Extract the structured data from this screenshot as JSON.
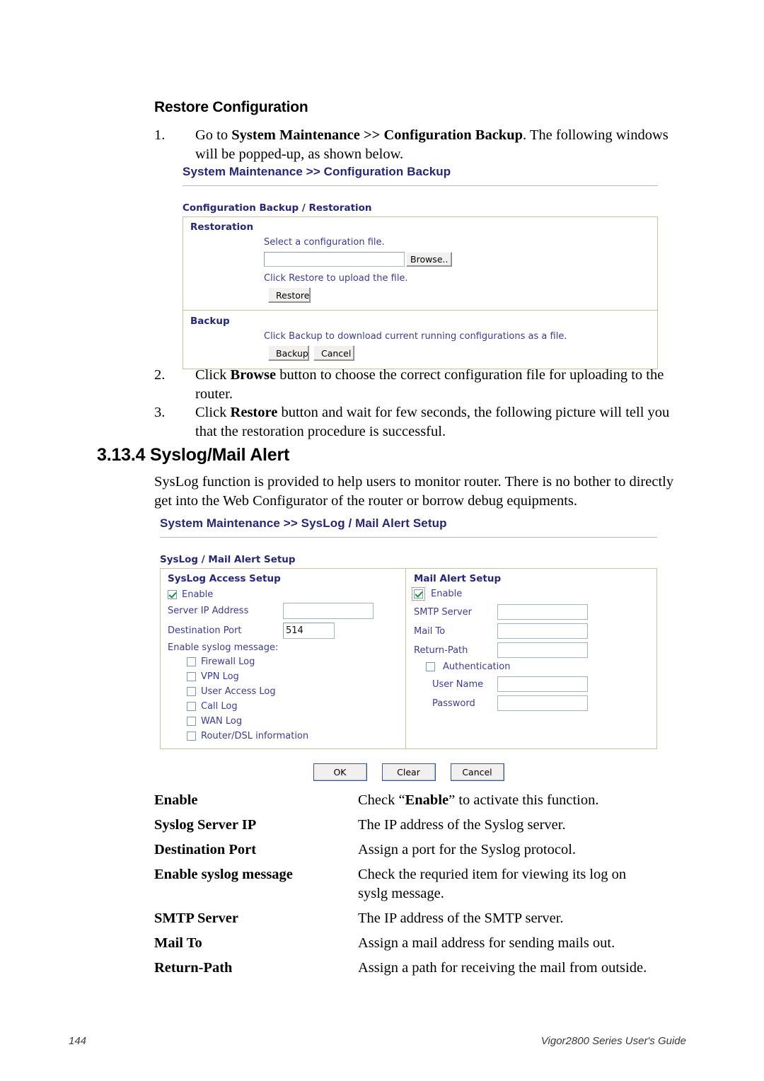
{
  "document": {
    "section_heading": "Restore Configuration",
    "chapter_heading": "3.13.4 Syslog/Mail Alert",
    "steps": [
      {
        "number": "1.",
        "parts": [
          {
            "t": "Go to ",
            "b": false
          },
          {
            "t": "System Maintenance >> Configuration Backup",
            "b": true
          },
          {
            "t": ". The following windows will be popped-up, as shown below.",
            "b": false
          }
        ]
      },
      {
        "number": "2.",
        "parts": [
          {
            "t": "Click ",
            "b": false
          },
          {
            "t": "Browse",
            "b": true
          },
          {
            "t": " button to choose the correct configuration file for uploading to the router.",
            "b": false
          }
        ]
      },
      {
        "number": "3.",
        "parts": [
          {
            "t": "Click ",
            "b": false
          },
          {
            "t": "Restore",
            "b": true
          },
          {
            "t": " button and wait for few seconds, the following picture will tell you that the restoration procedure is successful.",
            "b": false
          }
        ]
      }
    ],
    "intro_paragraph": "SysLog function is provided to help users to monitor router. There is no bother to directly get into the Web Configurator of the router or borrow debug equipments.",
    "definitions": [
      {
        "term": "Enable",
        "desc_pre": "Check “",
        "desc_bold": "Enable",
        "desc_post": "” to activate this function."
      },
      {
        "term": "Syslog Server IP",
        "desc_pre": "The IP address of the Syslog server.",
        "desc_bold": "",
        "desc_post": ""
      },
      {
        "term": "Destination Port",
        "desc_pre": "Assign a port for the Syslog protocol.",
        "desc_bold": "",
        "desc_post": ""
      },
      {
        "term": "Enable syslog message",
        "desc_pre": "Check the requried item for viewing its log on syslg message.",
        "desc_bold": "",
        "desc_post": ""
      },
      {
        "term": "SMTP Server",
        "desc_pre": "The IP address of the SMTP server.",
        "desc_bold": "",
        "desc_post": ""
      },
      {
        "term": "Mail To",
        "desc_pre": "Assign a mail address for sending mails out.",
        "desc_bold": "",
        "desc_post": ""
      },
      {
        "term": "Return-Path",
        "desc_pre": "Assign a path for receiving the mail from outside.",
        "desc_bold": "",
        "desc_post": ""
      }
    ],
    "footer": {
      "page_number": "144",
      "guide_name": "Vigor2800 Series User's Guide"
    }
  },
  "backup_panel": {
    "breadcrumb": "System Maintenance >> Configuration Backup",
    "box_title": "Configuration Backup / Restoration",
    "restoration": {
      "label": "Restoration",
      "select_text": "Select a configuration file.",
      "file_value": "",
      "browse_button": "Browse..",
      "click_restore_text": "Click Restore to upload the file.",
      "restore_button": "Restore"
    },
    "backup": {
      "label": "Backup",
      "description": "Click Backup to download current running configurations as a file.",
      "backup_button": "Backup",
      "cancel_button": "Cancel"
    }
  },
  "syslog_panel": {
    "breadcrumb": "System Maintenance >> SysLog / Mail Alert Setup",
    "box_title": "SysLog / Mail Alert Setup",
    "syslog_access": {
      "heading": "SysLog Access Setup",
      "enable_label": "Enable",
      "enable_checked": true,
      "server_ip_label": "Server IP Address",
      "server_ip_value": "",
      "dest_port_label": "Destination Port",
      "dest_port_value": "514",
      "messages_label": "Enable syslog message:",
      "messages": [
        {
          "label": "Firewall Log",
          "checked": false
        },
        {
          "label": "VPN Log",
          "checked": false
        },
        {
          "label": "User Access Log",
          "checked": false
        },
        {
          "label": "Call Log",
          "checked": false
        },
        {
          "label": "WAN Log",
          "checked": false
        },
        {
          "label": "Router/DSL information",
          "checked": false
        }
      ]
    },
    "mail_alert": {
      "heading": "Mail Alert Setup",
      "enable_label": "Enable",
      "enable_checked": true,
      "smtp_label": "SMTP Server",
      "smtp_value": "",
      "mailto_label": "Mail To",
      "mailto_value": "",
      "returnpath_label": "Return-Path",
      "returnpath_value": "",
      "auth_label": "Authentication",
      "auth_checked": false,
      "username_label": "User Name",
      "username_value": "",
      "password_label": "Password",
      "password_value": ""
    },
    "buttons": {
      "ok": "OK",
      "clear": "Clear",
      "cancel": "Cancel"
    }
  },
  "colors": {
    "ui_blue": "#26267a",
    "ui_text_blue": "#3b3b9a",
    "panel_border": "#c9c39a",
    "check_green": "#0a9a2e"
  }
}
